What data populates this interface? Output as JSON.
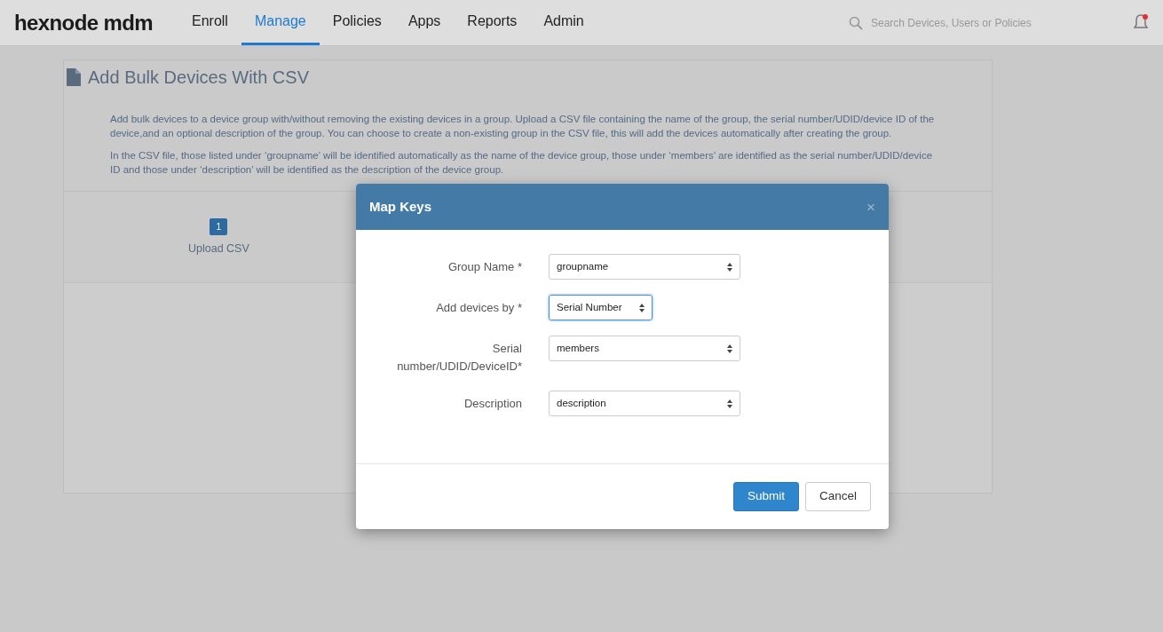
{
  "brand": {
    "logo": "hexnode mdm"
  },
  "nav": [
    {
      "label": "Enroll",
      "selected": false
    },
    {
      "label": "Manage",
      "selected": true
    },
    {
      "label": "Policies",
      "selected": false
    },
    {
      "label": "Apps",
      "selected": false
    },
    {
      "label": "Reports",
      "selected": false
    },
    {
      "label": "Admin",
      "selected": false
    }
  ],
  "search": {
    "placeholder": "Search Devices, Users or Policies"
  },
  "page": {
    "title": "Add Bulk Devices With CSV",
    "paragraphs": [
      "Add bulk devices to a device group with/without removing the existing devices in a group. Upload a CSV file containing the name of the group, the serial number/UDID/device ID of the device,and an optional description of the group. You can choose to create a non-existing group in the CSV file, this will add the devices automatically after creating the group.",
      "In the CSV file, those listed under ‘groupname’ will be identified automatically as the name of the device group, those under ‘members’ are identified as the serial number/UDID/device ID and those under ‘description’ will be identified as the description of the device group."
    ],
    "steps": [
      {
        "number": "1",
        "label": "Upload CSV",
        "selected": true
      }
    ]
  },
  "dialog": {
    "title": "Map Keys",
    "close": "×",
    "fields": [
      {
        "label": "Group Name *",
        "value": "groupname",
        "kind": "long",
        "focused": false
      },
      {
        "label": "Add devices by *",
        "value": "Serial Number",
        "kind": "short",
        "focused": true
      },
      {
        "label": "Serial number/UDID/DeviceID*",
        "value": "members",
        "kind": "long",
        "focused": false
      },
      {
        "label": "Description",
        "value": "description",
        "kind": "long",
        "focused": false
      }
    ],
    "buttons": [
      {
        "label": "Submit",
        "kind": "primary"
      },
      {
        "label": "Cancel",
        "kind": "secondary"
      }
    ]
  }
}
